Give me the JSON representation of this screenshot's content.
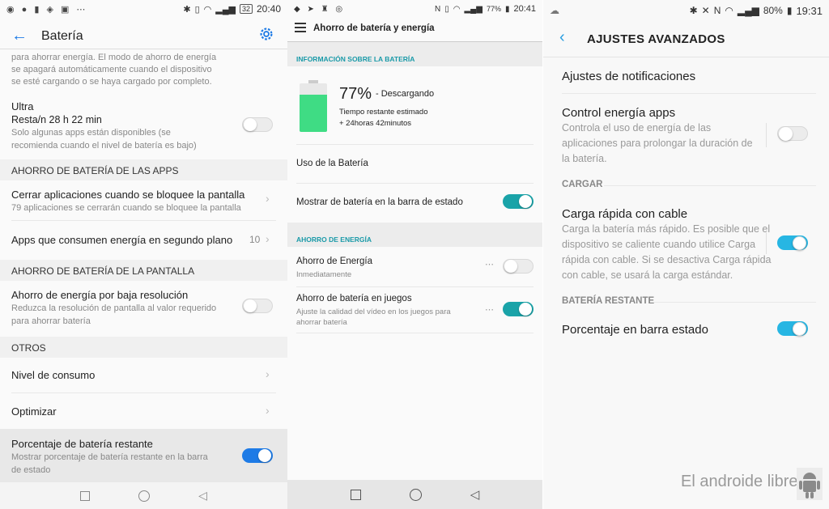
{
  "p1": {
    "status": {
      "time": "20:40",
      "battery": "32"
    },
    "header": {
      "title": "Batería"
    },
    "top_text": "para ahorrar energía. El modo de ahorro de energía\nse apagará automáticamente cuando el dispositivo\nse esté cargando o se haya cargado por completo.",
    "ultra": {
      "title": "Ultra",
      "subtitle": "Resta/n 28 h 22 min",
      "desc": "Solo algunas apps están disponibles (se\nrecomienda cuando el nivel de batería es bajo)",
      "enabled": false
    },
    "sec_apps": "AHORRO DE BATERÍA DE LAS APPS",
    "close_apps": {
      "title": "Cerrar aplicaciones cuando se bloquee la pantalla",
      "desc": "79 aplicaciones se cerrarán cuando se bloquee la pantalla"
    },
    "bg_apps": {
      "title": "Apps que consumen energía en segundo plano",
      "count": "10"
    },
    "sec_screen": "AHORRO DE BATERÍA DE LA PANTALLA",
    "low_res": {
      "title": "Ahorro de energía por baja resolución",
      "desc": "Reduzca la resolución de pantalla al valor requerido\npara ahorrar batería",
      "enabled": false
    },
    "sec_other": "OTROS",
    "consumo": "Nivel de consumo",
    "optimizar": "Optimizar",
    "percent": {
      "title": "Porcentaje de batería restante",
      "desc": "Mostrar porcentaje de batería restante en la barra\nde estado",
      "enabled": true
    },
    "accent": "#1e7be6"
  },
  "p2": {
    "status": {
      "time": "20:41",
      "battery": "77%"
    },
    "header": {
      "title": "Ahorro de batería y energía"
    },
    "sec_info": "INFORMACIÓN SOBRE LA BATERÍA",
    "battery": {
      "percent": "77%",
      "state": "- Descargando",
      "est_label": "Tiempo restante estimado",
      "est_value": "+ 24horas 42minutos",
      "level": 0.77
    },
    "uso": "Uso de la Batería",
    "show_status": {
      "title": "Mostrar de batería en la barra de estado",
      "enabled": true
    },
    "sec_saver": "AHORRO DE ENERGÍA",
    "saver": {
      "title": "Ahorro de Energía",
      "desc": "Inmediatamente",
      "enabled": false
    },
    "games": {
      "title": "Ahorro de batería en juegos",
      "desc": "Ajuste la calidad del vídeo en los juegos para\nahorrar batería",
      "enabled": true
    },
    "accent": "#1aa3a8"
  },
  "p3": {
    "status": {
      "time": "19:31",
      "battery": "80%"
    },
    "header": {
      "title": "AJUSTES AVANZADOS"
    },
    "notif": "Ajustes de notificaciones",
    "control": {
      "title": "Control energía apps",
      "desc": "Controla el uso de energía de las\naplicaciones para prolongar la duración de\nla batería.",
      "enabled": false
    },
    "sec_charge": "CARGAR",
    "fast": {
      "title": "Carga rápida con cable",
      "desc": "Carga la batería más rápido. Es posible que el\ndispositivo se caliente cuando utilice Carga\nrápida con cable. Si se desactiva Carga rápida\ncon cable, se usará la carga estándar.",
      "enabled": true
    },
    "sec_remain": "BATERÍA RESTANTE",
    "percent": {
      "title": "Porcentaje en barra estado",
      "enabled": true
    },
    "watermark": "El androide libre",
    "accent": "#27b6e3"
  }
}
